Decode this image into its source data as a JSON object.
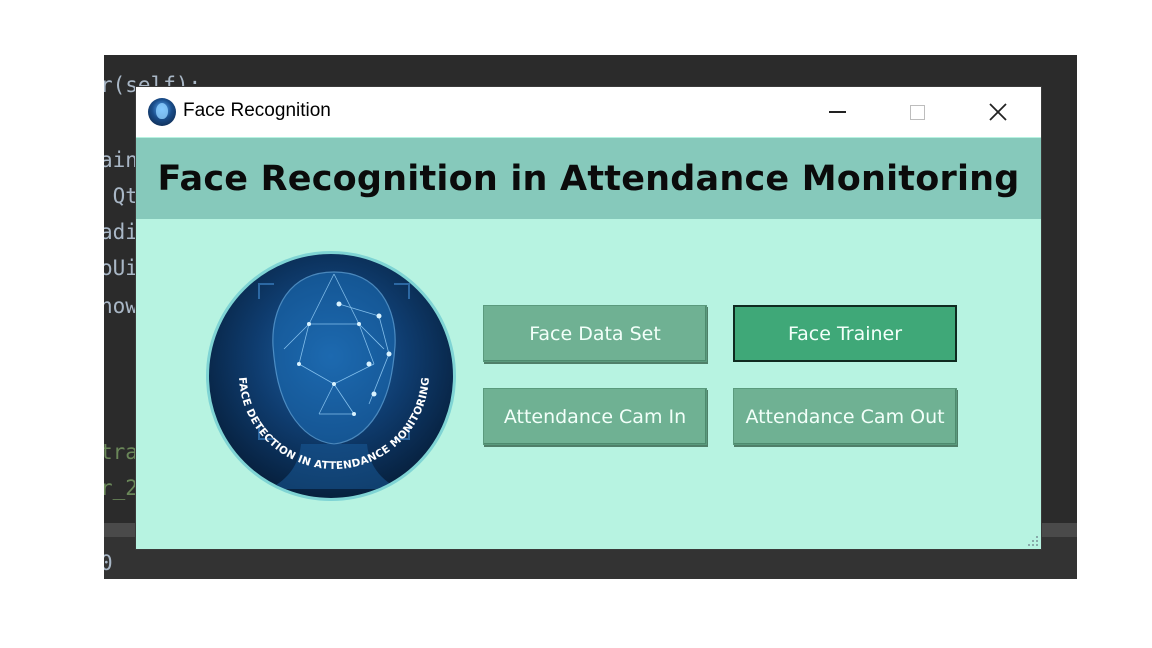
{
  "background_editor": {
    "lines": [
      {
        "text": "r(self):",
        "color": "#a9b7c6"
      },
      {
        "text": "ain",
        "color": "#a9b7c6"
      },
      {
        "text": " Qt",
        "color": "#a9b7c6"
      },
      {
        "text": "adi",
        "color": "#a9b7c6"
      },
      {
        "text": "oUi",
        "color": "#a9b7c6"
      },
      {
        "text": "how",
        "color": "#a9b7c6"
      },
      {
        "text": "tra",
        "color": "#6a8759"
      },
      {
        "text": "r_2",
        "color": "#6a8759"
      },
      {
        "text": "0",
        "color": "#a9b7c6"
      }
    ]
  },
  "window": {
    "title": "Face Recognition",
    "icon": "face-scan-app-icon",
    "controls": {
      "minimize": "minimize-icon",
      "maximize": "maximize-icon",
      "close": "close-icon"
    }
  },
  "header": {
    "title": "Face Recognition in Attendance Monitoring",
    "band_color": "#86c9bb"
  },
  "logo": {
    "ring_text": "FACE DETECTION IN ATTENDANCE MONITORING",
    "icon": "face-mesh-logo"
  },
  "buttons": {
    "face_data_set": "Face Data Set",
    "face_trainer": "Face Trainer",
    "attendance_cam_in": "Attendance Cam In",
    "attendance_cam_out": "Attendance Cam Out"
  },
  "colors": {
    "window_bg": "#b7f3e1",
    "button_bg": "#6fb193",
    "button_active_bg": "#3fa878"
  }
}
